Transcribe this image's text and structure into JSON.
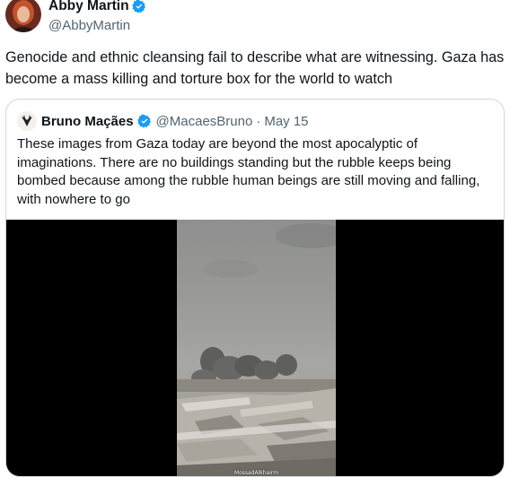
{
  "author": {
    "display_name": "Abby Martin",
    "handle": "@AbbyMartin",
    "avatar_icon": "profile-photo"
  },
  "tweet": {
    "text": "Genocide and ethnic cleansing fail to describe what are witnessing. Gaza has become a mass killing and torture box for the world to watch"
  },
  "quoted_tweet": {
    "display_name": "Bruno Maçães",
    "handle": "@MacaesBruno",
    "separator": "·",
    "date": "May 15",
    "text": "These images from Gaza today are beyond the most apocalyptic of imaginations. There are no buildings standing but the rubble keeps being bombed because among the rubble human beings are still moving and falling, with nowhere to go",
    "media": {
      "watermark": "MossadAlkhairm"
    }
  },
  "colors": {
    "text": "#0f1419",
    "secondary_text": "#536471",
    "verified_badge": "#1d9bf0",
    "border": "#cfd9de"
  },
  "icons": [
    "verified-badge-icon",
    "profile-photo",
    "deer-logo-avatar"
  ]
}
